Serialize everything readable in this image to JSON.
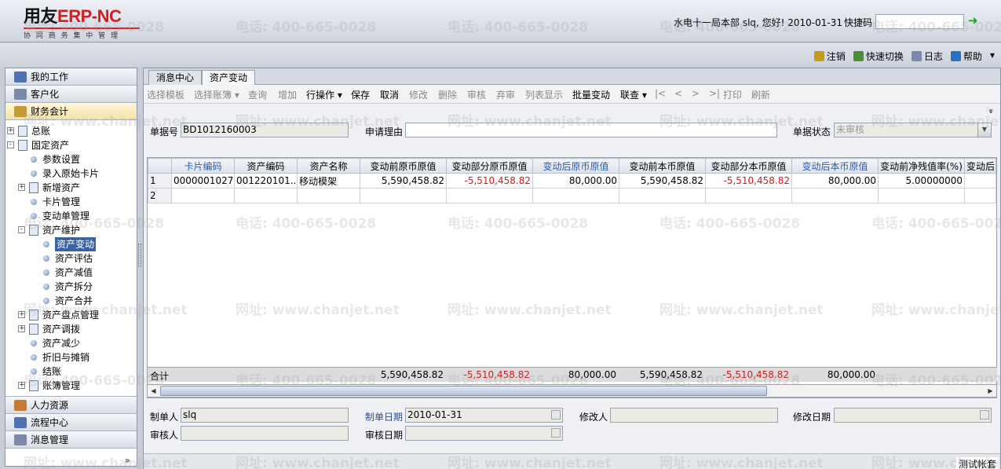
{
  "header": {
    "logo_brand_a": "用友",
    "logo_brand_b": "ERP-",
    "logo_brand_c": "NC",
    "logo_slogan": "协 同 商 务    集 中 管 理",
    "user_info": "水电十一局本部 slq, 您好! 2010-01-31",
    "quick_code_label": "快捷码",
    "quick_code_value": ""
  },
  "toplinks": [
    {
      "label": "注销",
      "icon": "key-icon",
      "color": "#c89a1c"
    },
    {
      "label": "快速切换",
      "icon": "switch-icon",
      "color": "#4a8e3a"
    },
    {
      "label": "日志",
      "icon": "log-icon",
      "color": "#7a8aa8"
    },
    {
      "label": "帮助",
      "icon": "help-icon",
      "color": "#2a6fc4"
    }
  ],
  "sidebar": {
    "sections_top": [
      {
        "label": "我的工作",
        "icon": "folder-icon",
        "color": "#4d73b5"
      },
      {
        "label": "客户化",
        "icon": "grid-icon",
        "color": "#7a8aa8"
      },
      {
        "label": "财务会计",
        "icon": "user-icon",
        "color": "#c79a35"
      }
    ],
    "tree": [
      {
        "label": "总账",
        "level": 0,
        "pm": "+",
        "kind": "doc"
      },
      {
        "label": "固定资产",
        "level": 0,
        "pm": "-",
        "kind": "doc"
      },
      {
        "label": "参数设置",
        "level": 1,
        "pm": "",
        "kind": "leaf"
      },
      {
        "label": "录入原始卡片",
        "level": 1,
        "pm": "",
        "kind": "leaf"
      },
      {
        "label": "新增资产",
        "level": 1,
        "pm": "+",
        "kind": "doc"
      },
      {
        "label": "卡片管理",
        "level": 1,
        "pm": "",
        "kind": "leaf"
      },
      {
        "label": "变动单管理",
        "level": 1,
        "pm": "",
        "kind": "leaf"
      },
      {
        "label": "资产维护",
        "level": 1,
        "pm": "-",
        "kind": "doc"
      },
      {
        "label": "资产变动",
        "level": 2,
        "pm": "",
        "kind": "leaf",
        "selected": true
      },
      {
        "label": "资产评估",
        "level": 2,
        "pm": "",
        "kind": "leaf"
      },
      {
        "label": "资产减值",
        "level": 2,
        "pm": "",
        "kind": "leaf"
      },
      {
        "label": "资产拆分",
        "level": 2,
        "pm": "",
        "kind": "leaf"
      },
      {
        "label": "资产合并",
        "level": 2,
        "pm": "",
        "kind": "leaf"
      },
      {
        "label": "资产盘点管理",
        "level": 1,
        "pm": "+",
        "kind": "doc"
      },
      {
        "label": "资产调拨",
        "level": 1,
        "pm": "+",
        "kind": "doc"
      },
      {
        "label": "资产减少",
        "level": 1,
        "pm": "",
        "kind": "leaf"
      },
      {
        "label": "折旧与摊销",
        "level": 1,
        "pm": "",
        "kind": "leaf"
      },
      {
        "label": "结账",
        "level": 1,
        "pm": "",
        "kind": "leaf"
      },
      {
        "label": "账簿管理",
        "level": 1,
        "pm": "+",
        "kind": "doc"
      }
    ],
    "sections_bottom": [
      {
        "label": "人力资源",
        "icon": "people-icon",
        "color": "#c77a35"
      },
      {
        "label": "流程中心",
        "icon": "flow-icon",
        "color": "#4d73b5"
      },
      {
        "label": "消息管理",
        "icon": "message-icon",
        "color": "#7a8aa8"
      }
    ],
    "more_glyph": "»"
  },
  "tabs": [
    "消息中心",
    "资产变动"
  ],
  "actions": [
    {
      "label": "选择模板",
      "enabled": false
    },
    {
      "label": "选择账簿 ▾",
      "enabled": false
    },
    {
      "label": "查询",
      "enabled": false
    },
    {
      "label": "增加",
      "enabled": false
    },
    {
      "label": "行操作 ▾",
      "enabled": true
    },
    {
      "label": "保存",
      "enabled": true
    },
    {
      "label": "取消",
      "enabled": true
    },
    {
      "label": "修改",
      "enabled": false
    },
    {
      "label": "删除",
      "enabled": false
    },
    {
      "label": "审核",
      "enabled": false
    },
    {
      "label": "弃审",
      "enabled": false
    },
    {
      "label": "列表显示",
      "enabled": false
    },
    {
      "label": "批量变动",
      "enabled": true
    },
    {
      "label": "联查 ▾",
      "enabled": true
    },
    {
      "label": "|<",
      "enabled": false
    },
    {
      "label": "<",
      "enabled": false
    },
    {
      "label": ">",
      "enabled": false
    },
    {
      "label": ">|",
      "enabled": false
    },
    {
      "label": "打印",
      "enabled": false
    },
    {
      "label": "刷新",
      "enabled": false
    }
  ],
  "form": {
    "bill_no_label": "单据号",
    "bill_no_value": "BD1012160003",
    "reason_label": "申请理由",
    "reason_value": "",
    "status_label": "单据状态",
    "status_value": "未审核",
    "collapse_glyph": "»"
  },
  "grid": {
    "columns": [
      {
        "label": "",
        "blue": false
      },
      {
        "label": "卡片编码",
        "blue": true
      },
      {
        "label": "资产编码",
        "blue": false
      },
      {
        "label": "资产名称",
        "blue": false
      },
      {
        "label": "变动前原币原值",
        "blue": false
      },
      {
        "label": "变动部分原币原值",
        "blue": false
      },
      {
        "label": "变动后原币原值",
        "blue": true
      },
      {
        "label": "变动前本币原值",
        "blue": false
      },
      {
        "label": "变动部分本币原值",
        "blue": false
      },
      {
        "label": "变动后本币原值",
        "blue": true
      },
      {
        "label": "变动前净残值率(%)",
        "blue": false
      },
      {
        "label": "变动后",
        "blue": false
      }
    ],
    "rows": [
      [
        "1",
        "0000001027",
        "001220101...",
        "移动模架",
        "5,590,458.82",
        "-5,510,458.82",
        "80,000.00",
        "5,590,458.82",
        "-5,510,458.82",
        "80,000.00",
        "5.00000000",
        ""
      ],
      [
        "2",
        "",
        "",
        "",
        "",
        "",
        "",
        "",
        "",
        "",
        "",
        ""
      ]
    ],
    "totals_label": "合计",
    "totals": [
      "",
      "",
      "",
      "5,590,458.82",
      "-5,510,458.82",
      "80,000.00",
      "5,590,458.82",
      "-5,510,458.82",
      "80,000.00",
      "",
      ""
    ]
  },
  "bottom_form": {
    "maker_label": "制单人",
    "maker_value": "slq",
    "make_date_label": "制单日期",
    "make_date_value": "2010-01-31",
    "modifier_label": "修改人",
    "modifier_value": "",
    "modify_date_label": "修改日期",
    "modify_date_value": "",
    "auditor_label": "审核人",
    "auditor_value": "",
    "audit_date_label": "审核日期",
    "audit_date_value": ""
  },
  "footer": {
    "account": "测试帐套"
  },
  "watermark": {
    "phone": "电话: 400-665-0028",
    "site": "网址: www.chanjet.net"
  }
}
